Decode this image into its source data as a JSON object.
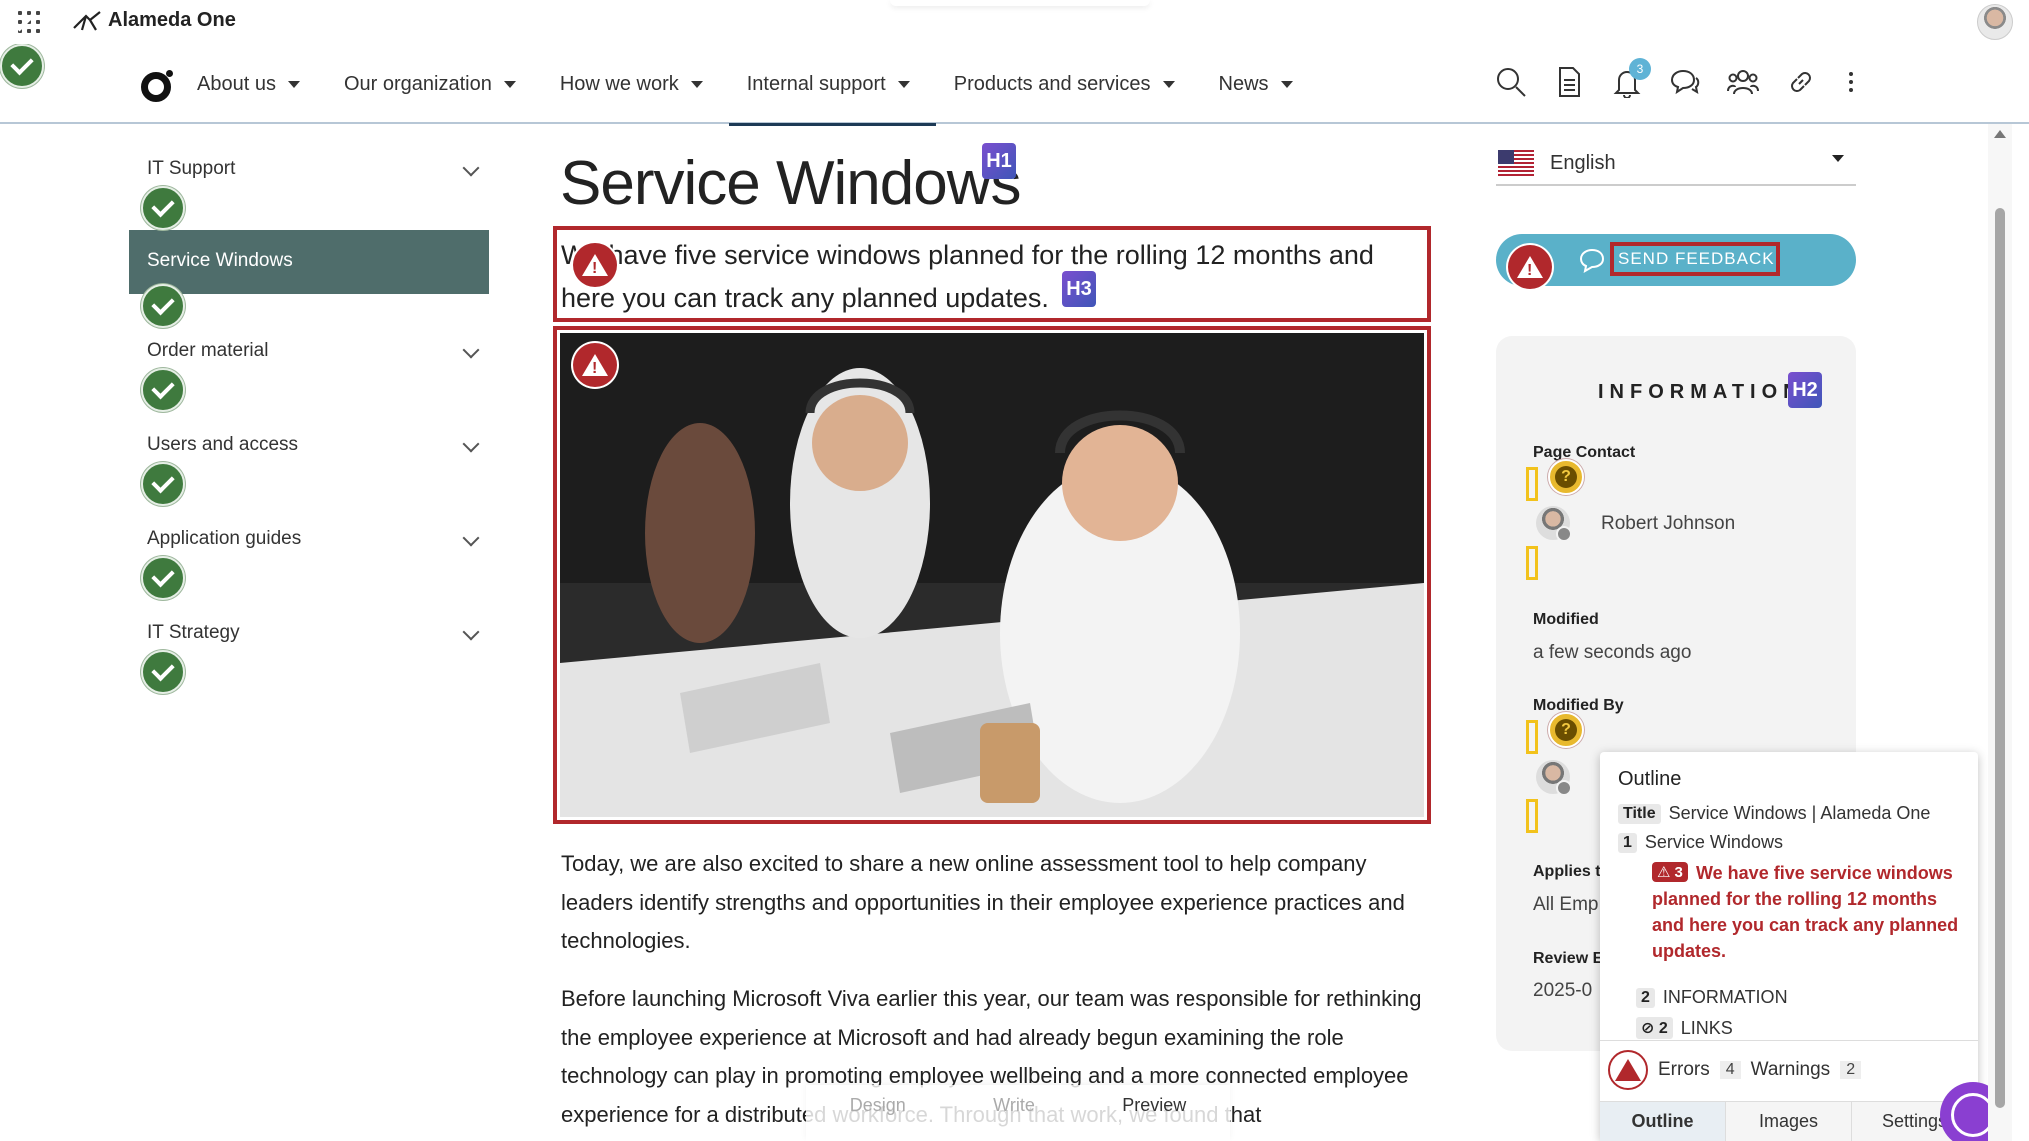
{
  "app": {
    "title": "Alameda One"
  },
  "nav": {
    "items": [
      {
        "label": "About us"
      },
      {
        "label": "Our organization"
      },
      {
        "label": "How we work"
      },
      {
        "label": "Internal support",
        "active": true
      },
      {
        "label": "Products and services"
      },
      {
        "label": "News"
      }
    ],
    "notification_count": "3",
    "icons": [
      "search-icon",
      "document-icon",
      "bell-icon",
      "chat-icon",
      "people-icon",
      "link-icon",
      "more-icon"
    ]
  },
  "sidebar": {
    "items": [
      {
        "label": "IT Support"
      },
      {
        "label": "Service Windows",
        "selected": true
      },
      {
        "label": "Order material"
      },
      {
        "label": "Users and access"
      },
      {
        "label": "Application guides"
      },
      {
        "label": "IT Strategy"
      }
    ]
  },
  "page": {
    "title": "Service Windows",
    "h1_badge": "H1",
    "h3_badge": "H3",
    "intro": "We have five service windows planned for the rolling 12 months and here you can track any planned updates.",
    "paragraph1": "Today, we are also excited to share a new online assessment tool to help company leaders identify strengths and opportunities in their employee experience practices and technologies.",
    "paragraph2": "Before launching Microsoft Viva earlier this year, our team was responsible for rethinking the employee experience at Microsoft and had already begun examining the role technology can play in promoting employee wellbeing and a more connected employee experience for a distributed workforce. Through that work, we found that"
  },
  "right": {
    "language": "English",
    "feedback_label": "SEND FEEDBACK",
    "info_title": "INFORMATION",
    "h2_badge": "H2",
    "page_contact_label": "Page Contact",
    "contact_name": "Robert Johnson",
    "modified_label": "Modified",
    "modified_value": "a few seconds ago",
    "modified_by_label": "Modified By",
    "applies_label": "Applies t",
    "applies_value": "All Emp",
    "review_label": "Review E",
    "review_value": "2025-0"
  },
  "outline": {
    "title": "Outline",
    "title_chip": "Title",
    "title_value": "Service Windows | Alameda One",
    "h1_num": "1",
    "h1_text": "Service Windows",
    "err_num": "3",
    "err_text": "We have five service windows planned for the rolling 12 months and here you can track any planned updates.",
    "h2_num": "2",
    "h2_text": "INFORMATION",
    "hidden_num": "2",
    "hidden_text": "LINKS",
    "errors_label": "Errors",
    "errors_count": "4",
    "warnings_label": "Warnings",
    "warnings_count": "2",
    "tabs": [
      {
        "label": "Outline",
        "active": true
      },
      {
        "label": "Images"
      },
      {
        "label": "Settings"
      }
    ]
  },
  "edit_bar": {
    "design": "Design",
    "write": "Write",
    "preview": "Preview"
  },
  "colors": {
    "error_red": "#b1282c",
    "success_green": "#3f7a3e",
    "sidebar_selected": "#4f6d6b",
    "feedback_blue": "#5ab1c9",
    "warning_yellow": "#e8b92e"
  }
}
